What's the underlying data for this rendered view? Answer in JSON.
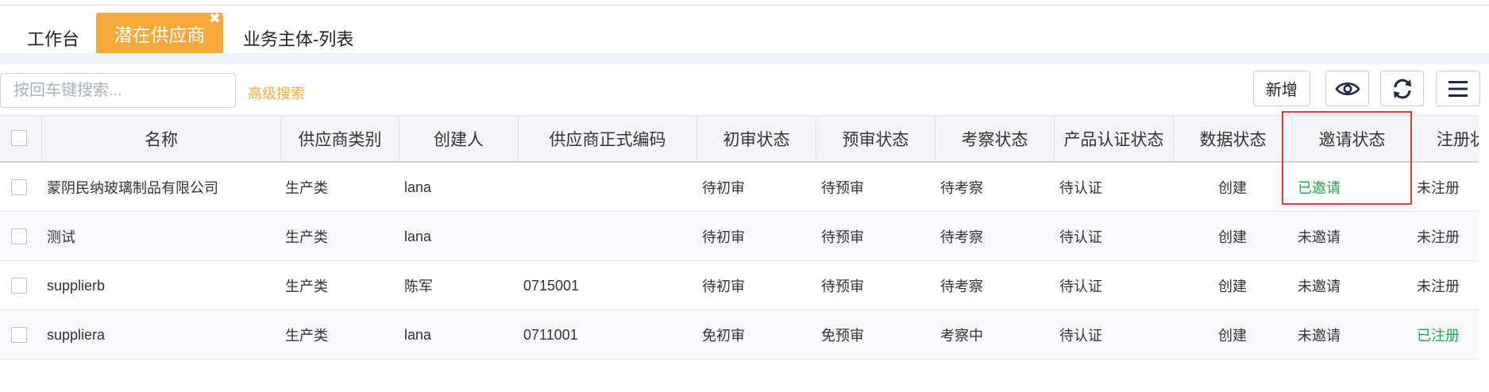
{
  "tabs": {
    "workbench": "工作台",
    "active": "潜在供应商",
    "active_close": "✖",
    "business": "业务主体-列表"
  },
  "toolbar": {
    "search_placeholder": "按回车键搜索...",
    "advanced_search": "高级搜索",
    "new_button": "新增"
  },
  "table": {
    "columns": [
      "名称",
      "供应商类别",
      "创建人",
      "供应商正式编码",
      "初审状态",
      "预审状态",
      "考察状态",
      "产品认证状态",
      "数据状态",
      "邀请状态",
      "注册状"
    ],
    "rows": [
      [
        "蒙阴民纳玻璃制品有限公司",
        "生产类",
        "lana",
        "",
        "待初审",
        "待预审",
        "待考察",
        "待认证",
        "创建",
        "已邀请",
        "未注册"
      ],
      [
        "测试",
        "生产类",
        "lana",
        "",
        "待初审",
        "待预审",
        "待考察",
        "待认证",
        "创建",
        "未邀请",
        "未注册"
      ],
      [
        "supplierb",
        "生产类",
        "陈军",
        "0715001",
        "待初审",
        "待预审",
        "待考察",
        "待认证",
        "创建",
        "未邀请",
        "未注册"
      ],
      [
        "suppliera",
        "生产类",
        "lana",
        "0711001",
        "免初审",
        "免预审",
        "考察中",
        "待认证",
        "创建",
        "未邀请",
        "已注册"
      ]
    ]
  },
  "colors": {
    "accent": "#f6a93b",
    "success": "#1ea84b",
    "highlight": "#e53935"
  },
  "icons": {
    "view": "eye-icon",
    "refresh": "refresh-icon",
    "columns": "menu-icon",
    "close": "close-icon"
  }
}
